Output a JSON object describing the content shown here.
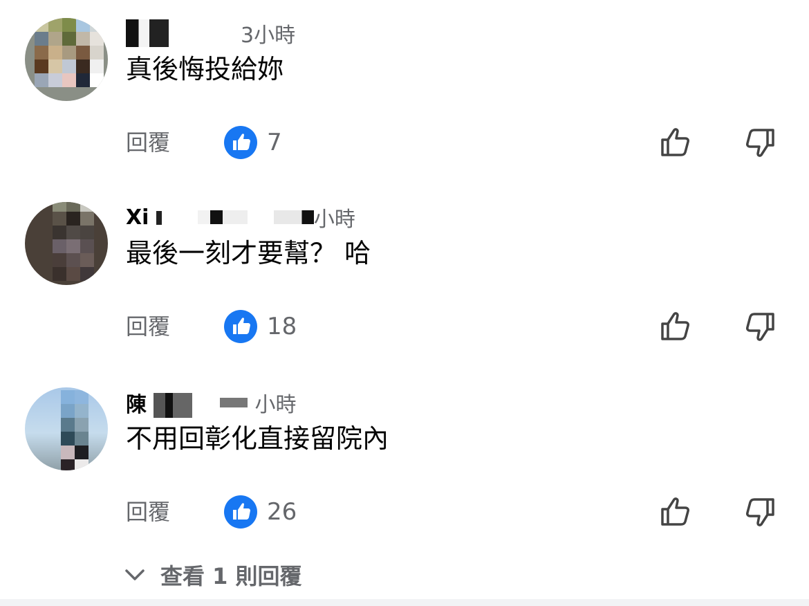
{
  "colors": {
    "like_blue": "#1877f2",
    "secondary_text": "#65676b",
    "primary_text": "#050505"
  },
  "comments": [
    {
      "name": "",
      "time": "3小時",
      "text": "真後悔投給妳",
      "reply_label": "回覆",
      "like_count": "7"
    },
    {
      "name": "Xi",
      "time": "小時",
      "text": "最後一刻才要幫？ 哈",
      "reply_label": "回覆",
      "like_count": "18"
    },
    {
      "name": "陳",
      "time": "小時",
      "text": "不用回彰化直接留院內",
      "reply_label": "回覆",
      "like_count": "26"
    }
  ],
  "view_replies_label": "查看 1 則回覆",
  "icons": {
    "like_badge": "thumbs-up-filled",
    "like_button": "thumbs-up-outline",
    "dislike_button": "thumbs-down-outline",
    "expand": "chevron-down"
  }
}
